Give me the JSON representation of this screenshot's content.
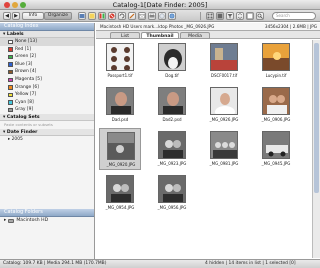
{
  "window": {
    "title": "Catalog-1[Date Finder: 2005]"
  },
  "toolbar": {
    "back_icon": "◀",
    "forward_icon": "▶",
    "info_label": "Info",
    "organize_label": "Organize",
    "search_placeholder": "Search"
  },
  "sidebar": {
    "catalog_index": "Catalog Index",
    "labels_title": "Labels",
    "labels": [
      {
        "name": "None [13]",
        "color": "#ffffff"
      },
      {
        "name": "Red [1]",
        "color": "#d83a2e"
      },
      {
        "name": "Green [2]",
        "color": "#3bb149"
      },
      {
        "name": "Blue [3]",
        "color": "#2f62d0"
      },
      {
        "name": "Brown [4]",
        "color": "#8a5a2b"
      },
      {
        "name": "Magenta [5]",
        "color": "#d23fb5"
      },
      {
        "name": "Orange [6]",
        "color": "#f08a1d"
      },
      {
        "name": "Yellow [7]",
        "color": "#f2e23a"
      },
      {
        "name": "Cyan [8]",
        "color": "#45c8df"
      },
      {
        "name": "Gray [9]",
        "color": "#9a9a9a"
      }
    ],
    "catalog_sets_title": "Catalog Sets",
    "catalog_sets_placeholder": "Paste contents or subsets",
    "date_finder_title": "Date Finder",
    "date_year": "2005",
    "catalog_folders_title": "Catalog Folders",
    "folder_name": "Macintosh HD"
  },
  "pathbar": {
    "path": "Macintosh HD Users mark...ktop Photos _MG_0926.JPG",
    "info": "3456x2304 | 2.6MB | JPG"
  },
  "tabs": [
    {
      "label": "List",
      "active": false
    },
    {
      "label": "Thumbnail",
      "active": true
    },
    {
      "label": "Media",
      "active": false
    }
  ],
  "thumbnails": [
    {
      "caption": "Passport1.tif",
      "kind": "passport"
    },
    {
      "caption": "Dog.tif",
      "kind": "dog"
    },
    {
      "caption": "DSCF0017.tif",
      "kind": "street"
    },
    {
      "caption": "Lucypin.tif",
      "kind": "sunset"
    },
    {
      "caption": "Dad.psd",
      "kind": "portrait"
    },
    {
      "caption": "Dad2.psd",
      "kind": "portrait"
    },
    {
      "caption": "_MG_0926.JPG",
      "kind": "bride"
    },
    {
      "caption": "_MG_0906.JPG",
      "kind": "couple"
    },
    {
      "caption": "_MG_0920.JPG",
      "kind": "grain",
      "selected": true
    },
    {
      "caption": "_MG_0923.JPG",
      "kind": "bw_couple"
    },
    {
      "caption": "_MG_0981.JPG",
      "kind": "bw_group"
    },
    {
      "caption": "_MG_0945.JPG",
      "kind": "car"
    },
    {
      "caption": "_MG_0954.JPG",
      "kind": "bw_couple"
    },
    {
      "caption": "_MG_0956.JPG",
      "kind": "bw_couple"
    }
  ],
  "status": {
    "left": "Catalog: 109.7 KB | Media 294.1 MB (170.7MB)",
    "middle": "4 hidden | 14 items in list | 1 selected [0]"
  }
}
